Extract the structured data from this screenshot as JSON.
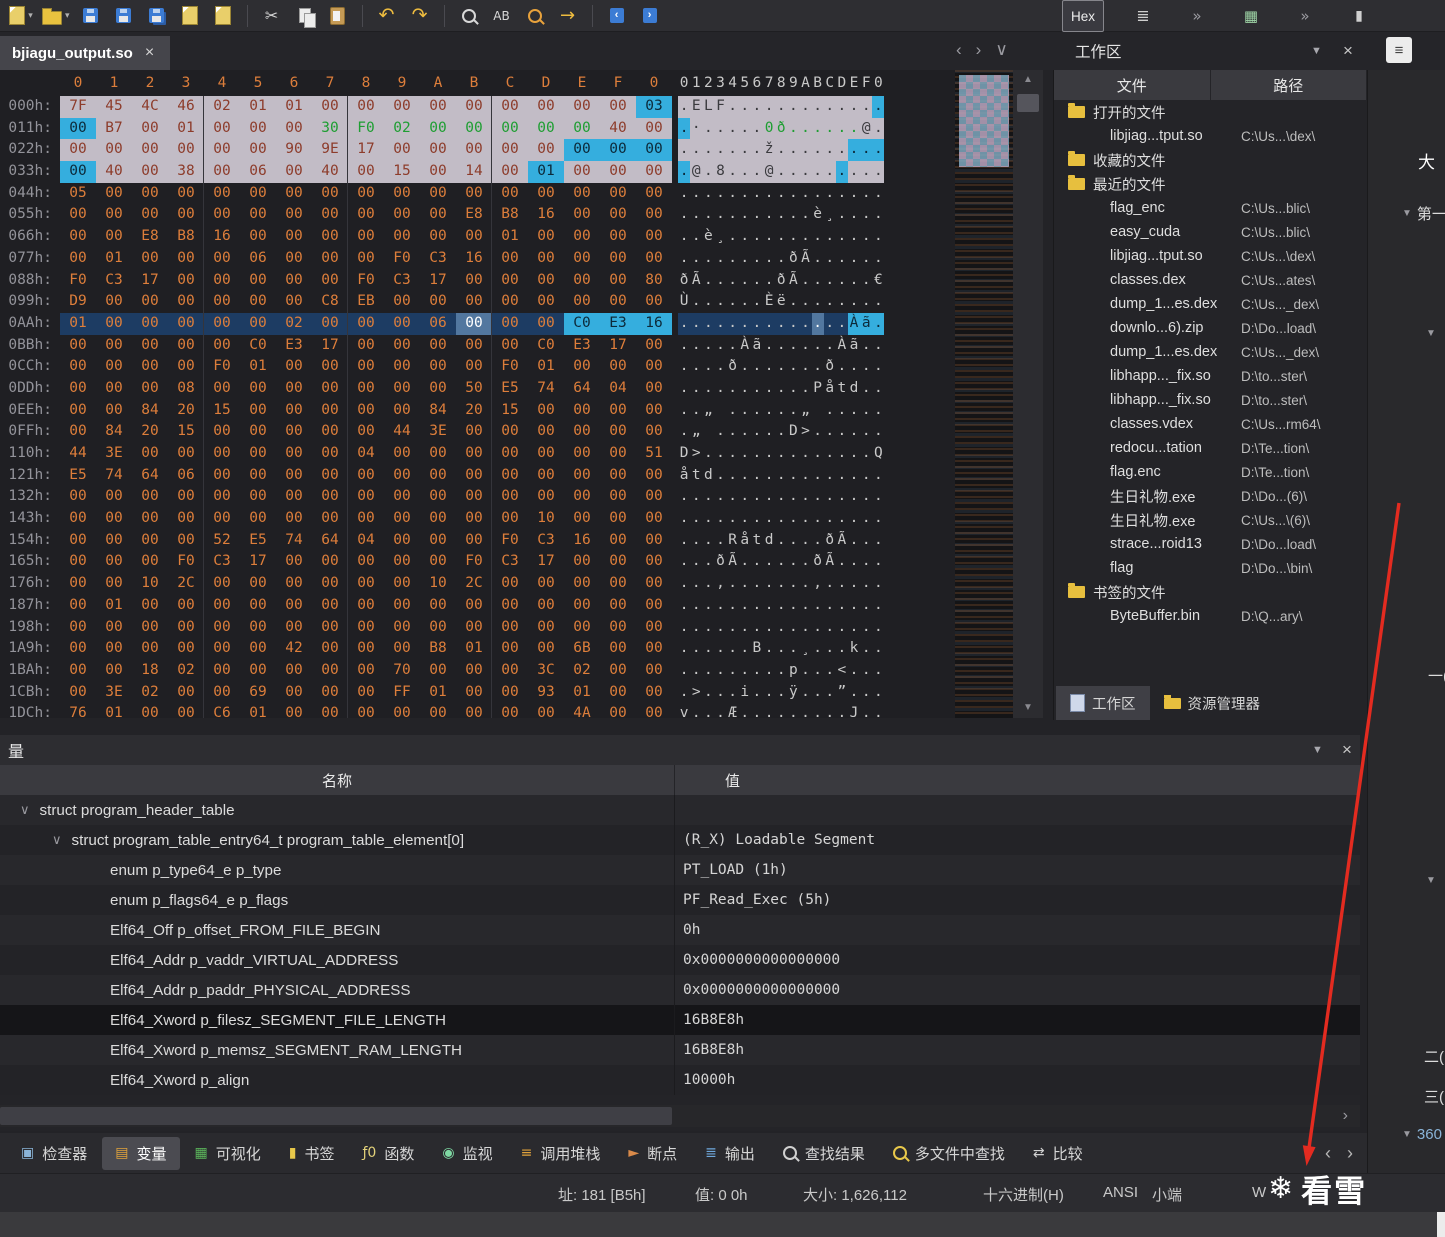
{
  "colors": {
    "byte_orange": "#dd7e3b",
    "highlight_cyan": "#35aede",
    "modified_green": "#1e9e32",
    "selected_row_blue": "#1d3c63",
    "header_band": "#c2bcc6",
    "annotation_red": "#e32b20"
  },
  "window": {
    "tab_title": "bjiagu_output.so"
  },
  "toolbar": {
    "items": [
      {
        "name": "new-file-button",
        "kind": "page",
        "dd": true
      },
      {
        "name": "open-file-button",
        "kind": "folder",
        "dd": true
      },
      {
        "name": "save-file-button",
        "kind": "floppy"
      },
      {
        "name": "save-as-button",
        "kind": "floppy"
      },
      {
        "name": "save-all-button",
        "kind": "floppyall"
      },
      {
        "name": "print-button",
        "kind": "page"
      },
      {
        "name": "print-preview-button",
        "kind": "page"
      },
      {
        "sep": true
      },
      {
        "name": "cut-button",
        "glyph": "✂",
        "color": "#d6d6d6",
        "size": 16
      },
      {
        "name": "copy-button",
        "kind": "copy"
      },
      {
        "name": "paste-button",
        "kind": "paste"
      },
      {
        "sep": true
      },
      {
        "name": "undo-button",
        "glyph": "↶",
        "color": "#eebc3f",
        "size": 19
      },
      {
        "name": "redo-button",
        "glyph": "↷",
        "color": "#eebc3f",
        "size": 19
      },
      {
        "sep": true
      },
      {
        "name": "find-button",
        "kind": "mag",
        "color": "#d8d8d8"
      },
      {
        "name": "find-text-button",
        "glyph": "AB",
        "color": "#d8d8d8",
        "size": 12
      },
      {
        "name": "replace-button",
        "kind": "mag",
        "color": "#e8a23c"
      },
      {
        "name": "goto-button",
        "glyph": "→",
        "color": "#eebc3f",
        "size": 18
      },
      {
        "sep": true
      },
      {
        "name": "prev-bookmark-button",
        "kind": "booknext",
        "glyph2": "‹"
      },
      {
        "name": "next-bookmark-button",
        "kind": "booknext",
        "glyph2": "›"
      }
    ],
    "right_items": [
      {
        "name": "hex-mode-button",
        "label": "Hex",
        "box": true
      },
      {
        "name": "template-list-button",
        "glyph": "≣",
        "color": "#cfcfcf",
        "size": 16
      },
      {
        "name": "toolbar-overflow-button",
        "glyph": "»",
        "color": "#9a9aa0",
        "size": 15
      },
      {
        "name": "calculator-button",
        "glyph": "▦",
        "color": "#9ed4a6",
        "size": 15
      },
      {
        "name": "toolbar-overflow-button-2",
        "glyph": "»",
        "color": "#9a9aa0",
        "size": 15
      },
      {
        "name": "pause-button",
        "glyph": "▮",
        "color": "#d0d0d0",
        "size": 14
      }
    ]
  },
  "tabbar": {
    "nav": [
      {
        "name": "prev-file-button",
        "glyph": "‹"
      },
      {
        "name": "next-file-button",
        "glyph": "›"
      },
      {
        "name": "file-list-button",
        "glyph": "∨"
      }
    ]
  },
  "hex": {
    "col_header": [
      "0",
      "1",
      "2",
      "3",
      "4",
      "5",
      "6",
      "7",
      "8",
      "9",
      "A",
      "B",
      "C",
      "D",
      "E",
      "F",
      "0"
    ],
    "ascii_header": "0123456789ABCDEF0",
    "rows": [
      {
        "addr": "000h:",
        "bytes": "7F 45 4C 46 02 01 01 00 00 00 00 00 00 00 00 00 03",
        "ascii": ".ELF.............",
        "cls": "hdr",
        "spans": [
          {
            "s": 16,
            "e": 16,
            "c": "cy"
          }
        ]
      },
      {
        "addr": "011h:",
        "bytes": "00 B7 00 01 00 00 00 30 F0 02 00 00 00 00 00 40 00",
        "ascii": ".·.....0ð......@.",
        "cls": "hdr",
        "spans": [
          {
            "s": 0,
            "e": 0,
            "c": "cy"
          },
          {
            "s": 7,
            "e": 14,
            "c": "gr"
          }
        ]
      },
      {
        "addr": "022h:",
        "bytes": "00 00 00 00 00 00 90 9E 17 00 00 00 00 00 00 00 00",
        "ascii": ".......ž.........",
        "cls": "hdr",
        "spans": [
          {
            "s": 14,
            "e": 16,
            "c": "cy"
          }
        ]
      },
      {
        "addr": "033h:",
        "bytes": "00 40 00 38 00 06 00 40 00 15 00 14 00 01 00 00 00",
        "ascii": ".@.8...@.........",
        "cls": "hdr",
        "spans": [
          {
            "s": 0,
            "e": 0,
            "c": "cy"
          },
          {
            "s": 13,
            "e": 13,
            "c": "cy"
          }
        ]
      },
      {
        "addr": "044h:",
        "bytes": "05 00 00 00 00 00 00 00 00 00 00 00 00 00 00 00 00",
        "ascii": "................."
      },
      {
        "addr": "055h:",
        "bytes": "00 00 00 00 00 00 00 00 00 00 00 E8 B8 16 00 00 00",
        "ascii": "...........è¸...."
      },
      {
        "addr": "066h:",
        "bytes": "00 00 E8 B8 16 00 00 00 00 00 00 00 01 00 00 00 00",
        "ascii": "..è¸............."
      },
      {
        "addr": "077h:",
        "bytes": "00 01 00 00 00 06 00 00 00 F0 C3 16 00 00 00 00 00",
        "ascii": ".........ðÃ......"
      },
      {
        "addr": "088h:",
        "bytes": "F0 C3 17 00 00 00 00 00 F0 C3 17 00 00 00 00 00 80",
        "ascii": "ðÃ......ðÃ......€"
      },
      {
        "addr": "099h:",
        "bytes": "D9 00 00 00 00 00 00 C8 EB 00 00 00 00 00 00 00 00",
        "ascii": "Ù......Èë........"
      },
      {
        "addr": "0AAh:",
        "bytes": "01 00 00 00 00 00 02 00 00 00 06 00 00 00 C0 E3 16",
        "ascii": "..............Àã.",
        "cls": "sel",
        "spans": [
          {
            "s": 11,
            "e": 11,
            "c": "cur"
          },
          {
            "s": 14,
            "e": 16,
            "c": "cy"
          }
        ]
      },
      {
        "addr": "0BBh:",
        "bytes": "00 00 00 00 00 C0 E3 17 00 00 00 00 00 C0 E3 17 00",
        "ascii": ".....Àã......Àã.."
      },
      {
        "addr": "0CCh:",
        "bytes": "00 00 00 00 F0 01 00 00 00 00 00 00 F0 01 00 00 00",
        "ascii": "....ð.......ð...."
      },
      {
        "addr": "0DDh:",
        "bytes": "00 00 00 08 00 00 00 00 00 00 00 50 E5 74 64 04 00",
        "ascii": "...........Påtd.."
      },
      {
        "addr": "0EEh:",
        "bytes": "00 00 84 20 15 00 00 00 00 00 84 20 15 00 00 00 00",
        "ascii": "..„ ......„ ....."
      },
      {
        "addr": "0FFh:",
        "bytes": "00 84 20 15 00 00 00 00 00 44 3E 00 00 00 00 00 00",
        "ascii": ".„ ......D>......"
      },
      {
        "addr": "110h:",
        "bytes": "44 3E 00 00 00 00 00 00 04 00 00 00 00 00 00 00 51",
        "ascii": "D>..............Q"
      },
      {
        "addr": "121h:",
        "bytes": "E5 74 64 06 00 00 00 00 00 00 00 00 00 00 00 00 00",
        "ascii": "åtd.............."
      },
      {
        "addr": "132h:",
        "bytes": "00 00 00 00 00 00 00 00 00 00 00 00 00 00 00 00 00",
        "ascii": "................."
      },
      {
        "addr": "143h:",
        "bytes": "00 00 00 00 00 00 00 00 00 00 00 00 00 10 00 00 00",
        "ascii": "................."
      },
      {
        "addr": "154h:",
        "bytes": "00 00 00 00 52 E5 74 64 04 00 00 00 F0 C3 16 00 00",
        "ascii": "....Råtd....ðÃ..."
      },
      {
        "addr": "165h:",
        "bytes": "00 00 00 F0 C3 17 00 00 00 00 00 F0 C3 17 00 00 00",
        "ascii": "...ðÃ......ðÃ...."
      },
      {
        "addr": "176h:",
        "bytes": "00 00 10 2C 00 00 00 00 00 00 10 2C 00 00 00 00 00",
        "ascii": "...,.......,....."
      },
      {
        "addr": "187h:",
        "bytes": "00 01 00 00 00 00 00 00 00 00 00 00 00 00 00 00 00",
        "ascii": "................."
      },
      {
        "addr": "198h:",
        "bytes": "00 00 00 00 00 00 00 00 00 00 00 00 00 00 00 00 00",
        "ascii": "................."
      },
      {
        "addr": "1A9h:",
        "bytes": "00 00 00 00 00 00 42 00 00 00 B8 01 00 00 6B 00 00",
        "ascii": "......B...¸...k.."
      },
      {
        "addr": "1BAh:",
        "bytes": "00 00 18 02 00 00 00 00 00 70 00 00 00 3C 02 00 00",
        "ascii": ".........p...<..."
      },
      {
        "addr": "1CBh:",
        "bytes": "00 3E 02 00 00 69 00 00 00 FF 01 00 00 93 01 00 00",
        "ascii": ".>...i...ÿ...”..."
      },
      {
        "addr": "1DCh:",
        "bytes": "76 01 00 00 C6 01 00 00 00 00 00 00 00 00 4A 00 00",
        "ascii": "v...Æ.........J.."
      }
    ]
  },
  "workspace": {
    "title": "工作区",
    "columns": [
      "文件",
      "路径"
    ],
    "tree": [
      {
        "type": "folder",
        "label": "打开的文件"
      },
      {
        "type": "file",
        "label": "libjiag...tput.so",
        "path": "C:\\Us...\\dex\\"
      },
      {
        "type": "folder",
        "label": "收藏的文件"
      },
      {
        "type": "folder",
        "label": "最近的文件"
      },
      {
        "type": "file",
        "label": "flag_enc",
        "path": "C:\\Us...blic\\"
      },
      {
        "type": "file",
        "label": "easy_cuda",
        "path": "C:\\Us...blic\\"
      },
      {
        "type": "file",
        "label": "libjiag...tput.so",
        "path": "C:\\Us...\\dex\\"
      },
      {
        "type": "file",
        "label": "classes.dex",
        "path": "C:\\Us...ates\\"
      },
      {
        "type": "file",
        "label": "dump_1...es.dex",
        "path": "C:\\Us..._dex\\"
      },
      {
        "type": "file",
        "label": "downlo...6).zip",
        "path": "D:\\Do...load\\"
      },
      {
        "type": "file",
        "label": "dump_1...es.dex",
        "path": "C:\\Us..._dex\\"
      },
      {
        "type": "file",
        "label": "libhapp..._fix.so",
        "path": "D:\\to...ster\\"
      },
      {
        "type": "file",
        "label": "libhapp..._fix.so",
        "path": "D:\\to...ster\\"
      },
      {
        "type": "file",
        "label": "classes.vdex",
        "path": "C:\\Us...rm64\\"
      },
      {
        "type": "file",
        "label": "redocu...tation",
        "path": "D:\\Te...tion\\"
      },
      {
        "type": "file",
        "label": "flag.enc",
        "path": "D:\\Te...tion\\"
      },
      {
        "type": "file",
        "label": "生日礼物.exe",
        "path": "D:\\Do...(6)\\"
      },
      {
        "type": "file",
        "label": "生日礼物.exe",
        "path": "C:\\Us...\\(6)\\"
      },
      {
        "type": "file",
        "label": "strace...roid13",
        "path": "D:\\Do...load\\"
      },
      {
        "type": "file",
        "label": "flag",
        "path": "D:\\Do...\\bin\\"
      },
      {
        "type": "folder",
        "label": "书签的文件"
      },
      {
        "type": "file",
        "label": "ByteBuffer.bin",
        "path": "D:\\Q...ary\\"
      }
    ],
    "bottom_tabs": [
      {
        "label": "工作区",
        "active": true
      },
      {
        "label": "资源管理器",
        "active": false
      }
    ]
  },
  "variables": {
    "title": "量",
    "columns": [
      "名称",
      "值"
    ],
    "rows": [
      {
        "indent": 0,
        "chev": true,
        "name": "struct program_header_table",
        "value": ""
      },
      {
        "indent": 1,
        "chev": true,
        "name": "struct program_table_entry64_t program_table_element[0]",
        "value": "(R_X) Loadable Segment"
      },
      {
        "indent": 2,
        "chev": false,
        "name": "enum p_type64_e p_type",
        "value": "PT_LOAD (1h)"
      },
      {
        "indent": 2,
        "chev": false,
        "name": "enum p_flags64_e p_flags",
        "value": "PF_Read_Exec (5h)"
      },
      {
        "indent": 2,
        "chev": false,
        "name": "Elf64_Off p_offset_FROM_FILE_BEGIN",
        "value": "0h"
      },
      {
        "indent": 2,
        "chev": false,
        "name": "Elf64_Addr p_vaddr_VIRTUAL_ADDRESS",
        "value": "0x0000000000000000"
      },
      {
        "indent": 2,
        "chev": false,
        "name": "Elf64_Addr p_paddr_PHYSICAL_ADDRESS",
        "value": "0x0000000000000000"
      },
      {
        "indent": 2,
        "chev": false,
        "name": "Elf64_Xword p_filesz_SEGMENT_FILE_LENGTH",
        "value": "16B8E8h",
        "selected": true
      },
      {
        "indent": 2,
        "chev": false,
        "name": "Elf64_Xword p_memsz_SEGMENT_RAM_LENGTH",
        "value": "16B8E8h"
      },
      {
        "indent": 2,
        "chev": false,
        "name": "Elf64_Xword p_align",
        "value": "10000h"
      }
    ]
  },
  "bottom_tabs": [
    {
      "id": "inspector",
      "label": "检查器",
      "glyph": "▣",
      "color": "#8ab4d8"
    },
    {
      "id": "variables",
      "label": "变量",
      "glyph": "▤",
      "color": "#e0a23c",
      "active": true
    },
    {
      "id": "visualization",
      "label": "可视化",
      "glyph": "▦",
      "color": "#5cb85c"
    },
    {
      "id": "bookmarks",
      "label": "书签",
      "glyph": "▮",
      "color": "#e8c84a"
    },
    {
      "id": "functions",
      "label": "函数",
      "glyph": "ƒ0",
      "color": "#e3d27a"
    },
    {
      "id": "watch",
      "label": "监视",
      "glyph": "◉",
      "color": "#7fd9a3"
    },
    {
      "id": "callstack",
      "label": "调用堆栈",
      "glyph": "≡",
      "color": "#e0a23c"
    },
    {
      "id": "breakpoints",
      "label": "断点",
      "glyph": "►",
      "color": "#d98a4a"
    },
    {
      "id": "output",
      "label": "输出",
      "glyph": "≣",
      "color": "#6fa8dc"
    },
    {
      "id": "find-results",
      "label": "查找结果",
      "kind": "mag",
      "color": "#d0d0d0"
    },
    {
      "id": "find-in-files",
      "label": "多文件中查找",
      "kind": "mag",
      "color": "#e8c84a"
    },
    {
      "id": "compare",
      "label": "比较",
      "glyph": "⇄",
      "color": "#d0d0d0"
    }
  ],
  "bottom_tabs_nav": [
    "‹",
    "›"
  ],
  "status_bar": {
    "address": "址: 181 [B5h]",
    "value": "值: 0 0h",
    "size": "大小: 1,626,112",
    "radix": "十六进制(H)",
    "encoding": "ANSI",
    "endian": "小端",
    "mode": "W"
  },
  "right_strip": {
    "items": [
      {
        "label": "大",
        "caret": false
      },
      {
        "label": "第一",
        "caret": true
      },
      {
        "label": "",
        "caret": true
      },
      {
        "label": "一(",
        "caret": false
      },
      {
        "label": "",
        "caret": true
      },
      {
        "label": "二(",
        "caret": false
      },
      {
        "label": "三(",
        "caret": false
      },
      {
        "label": "360",
        "caret": true
      }
    ]
  },
  "watermark": {
    "logo": "❄",
    "text": "看雪"
  }
}
